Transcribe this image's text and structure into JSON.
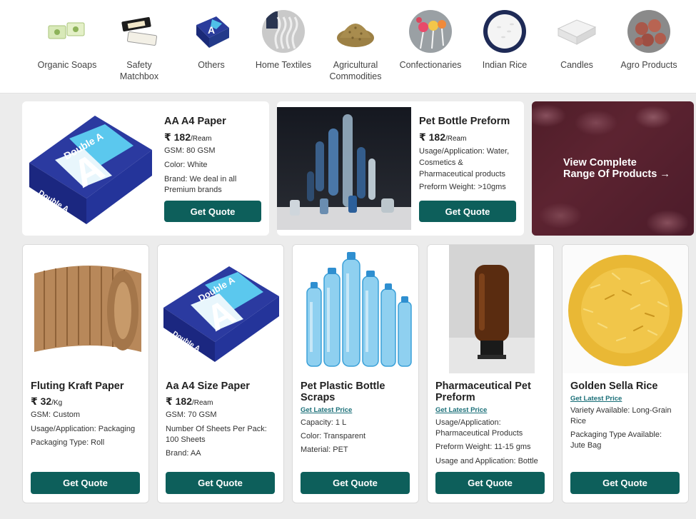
{
  "categories": [
    {
      "label": "Organic Soaps",
      "icon": "soap-icon"
    },
    {
      "label": "Safety\nMatchbox",
      "icon": "matchbox-icon"
    },
    {
      "label": "Others",
      "icon": "paper-ream-icon"
    },
    {
      "label": "Home Textiles",
      "icon": "textile-icon"
    },
    {
      "label": "Agricultural\nCommodities",
      "icon": "grain-icon"
    },
    {
      "label": "Confectionaries",
      "icon": "candy-icon"
    },
    {
      "label": "Indian Rice",
      "icon": "rice-icon"
    },
    {
      "label": "Candles",
      "icon": "candle-icon"
    },
    {
      "label": "Agro Products",
      "icon": "onion-icon"
    }
  ],
  "featured": [
    {
      "title": "AA A4 Paper",
      "price": "₹ 182",
      "unit": "/Ream",
      "specs": [
        "GSM: 80 GSM",
        "Color: White",
        "Brand: We deal in all Premium brands"
      ],
      "button": "Get Quote"
    },
    {
      "title": "Pet Bottle Preform",
      "price": "₹ 182",
      "unit": "/Ream",
      "specs": [
        "Usage/Application: Water, Cosmetics & Pharmaceutical products",
        "Preform Weight: >10gms"
      ],
      "button": "Get Quote"
    }
  ],
  "view_all": {
    "line1": "View Complete",
    "line2": "Range Of Products",
    "arrow": "→"
  },
  "products": [
    {
      "title": "Fluting Kraft Paper",
      "price": "₹ 32",
      "unit": "/Kg",
      "link": "",
      "specs": [
        "GSM: Custom",
        "Usage/Application: Packaging",
        "Packaging Type: Roll"
      ],
      "button": "Get Quote"
    },
    {
      "title": "Aa A4 Size Paper",
      "price": "₹ 182",
      "unit": "/Ream",
      "link": "",
      "specs": [
        "GSM: 70 GSM",
        "Number Of Sheets Per Pack: 100 Sheets",
        "Brand: AA"
      ],
      "button": "Get Quote"
    },
    {
      "title": "Pet Plastic Bottle Scraps",
      "price": "",
      "unit": "",
      "link": "Get Latest Price",
      "specs": [
        "Capacity: 1 L",
        "Color: Transparent",
        "Material: PET"
      ],
      "button": "Get Quote"
    },
    {
      "title": "Pharmaceutical Pet Preform",
      "price": "",
      "unit": "",
      "link": "Get Latest Price",
      "specs": [
        "Usage/Application: Pharmaceutical Products",
        "Preform Weight: 11-15 gms",
        "Usage and Application: Bottle"
      ],
      "button": "Get Quote"
    },
    {
      "title": "Golden Sella Rice",
      "price": "",
      "unit": "",
      "link": "Get Latest Price",
      "specs": [
        "Variety Available: Long-Grain Rice",
        "Packaging Type Available: Jute Bag"
      ],
      "button": "Get Quote"
    }
  ],
  "colors": {
    "button": "#0d5f5b",
    "link": "#1a6f78"
  }
}
